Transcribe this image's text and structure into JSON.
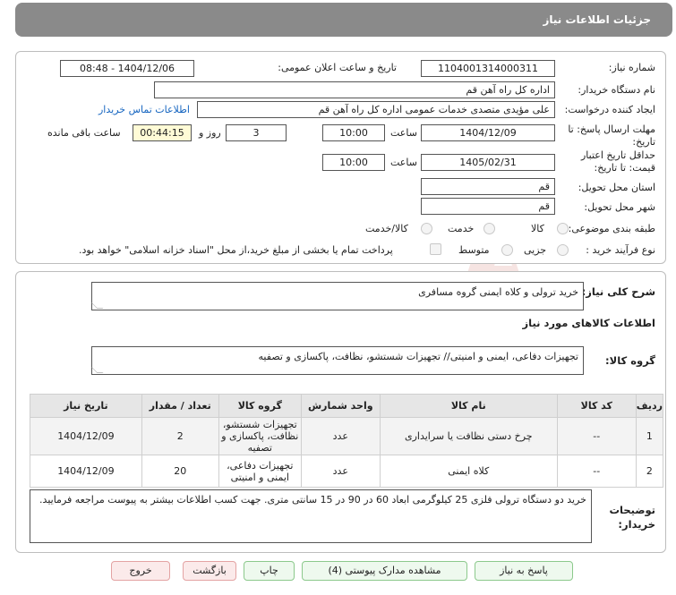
{
  "header": {
    "title": "جزئیات اطلاعات نیاز"
  },
  "form": {
    "need_number_label": "شماره نیاز:",
    "need_number": "1104001314000311",
    "announce_label": "تاریخ و ساعت اعلان عمومی:",
    "announce_value": "1404/12/06 - 08:48",
    "buyer_org_label": "نام دستگاه خریدار:",
    "buyer_org": "اداره کل  راه آهن قم",
    "creator_label": "ایجاد کننده درخواست:",
    "creator": "علی مؤیدی متصدی خدمات عمومی اداره کل  راه آهن قم",
    "contact_link": "اطلاعات تماس خریدار",
    "deadline_label": "مهلت ارسال پاسخ: تا تاریخ:",
    "deadline_date": "1404/12/09",
    "time_label": "ساعت",
    "deadline_time": "10:00",
    "days_value": "3",
    "days_label": "روز و",
    "remaining_time": "00:44:15",
    "remaining_label": "ساعت باقی مانده",
    "validity_label": "حداقل تاریخ اعتبار قیمت: تا تاریخ:",
    "validity_date": "1405/02/31",
    "validity_time": "10:00",
    "province_label": "استان محل تحویل:",
    "province": "قم",
    "city_label": "شهر محل تحویل:",
    "city": "قم",
    "category_label": "طبقه بندی موضوعی:",
    "category_options": [
      "کالا",
      "خدمت",
      "کالا/خدمت"
    ],
    "process_label": "نوع فرآیند خرید :",
    "process_options": [
      "جزیی",
      "متوسط"
    ],
    "payment_note": "پرداخت تمام یا بخشی از مبلغ خرید،از محل \"اسناد خزانه اسلامی\" خواهد بود."
  },
  "summary": {
    "label": "شرح کلی نیاز:",
    "value": "خرید ترولی و کلاه ایمنی گروه مسافری",
    "goods_info_title": "اطلاعات کالاهای مورد نیاز",
    "goods_group_label": "گروه کالا:",
    "goods_group_value": "تجهیزات دفاعی، ایمنی و امنیتی// تجهیزات شستشو، نظافت، پاکسازی و تصفیه"
  },
  "table": {
    "headers": [
      "ردیف",
      "کد کالا",
      "نام کالا",
      "واحد شمارش",
      "گروه کالا",
      "تعداد / مقدار",
      "تاریخ نیاز"
    ],
    "rows": [
      {
        "row": "1",
        "code": "--",
        "name": "چرخ دستی نظافت یا سرایداری",
        "unit": "عدد",
        "group": "تجهیزات شستشو، نظافت، پاکسازی و تصفیه",
        "qty": "2",
        "date": "1404/12/09"
      },
      {
        "row": "2",
        "code": "--",
        "name": "کلاه ایمنی",
        "unit": "عدد",
        "group": "تجهیزات دفاعی، ایمنی و امنیتی",
        "qty": "20",
        "date": "1404/12/09"
      }
    ]
  },
  "notes": {
    "label": "توضیحات خریدار:",
    "value": "خرید دو دستگاه ترولی فلزی 25 کیلوگرمی ابعاد 60 در 90 در 15 سانتی متری. جهت کسب اطلاعات بیشتر به پیوست مراجعه فرمایید."
  },
  "buttons": {
    "reply": "پاسخ به نیاز",
    "attachments": "مشاهده مدارک پیوستی (4)",
    "print": "چاپ",
    "back": "بازگشت",
    "exit": "خروج"
  },
  "watermark": {
    "text": "AriaTender.neT"
  },
  "colors": {
    "header_bg": "#8a8a8a",
    "link": "#1565c0",
    "remaining_bg": "#fffbd6",
    "button_green": "#eef9ee",
    "button_red": "#fbeaea"
  }
}
